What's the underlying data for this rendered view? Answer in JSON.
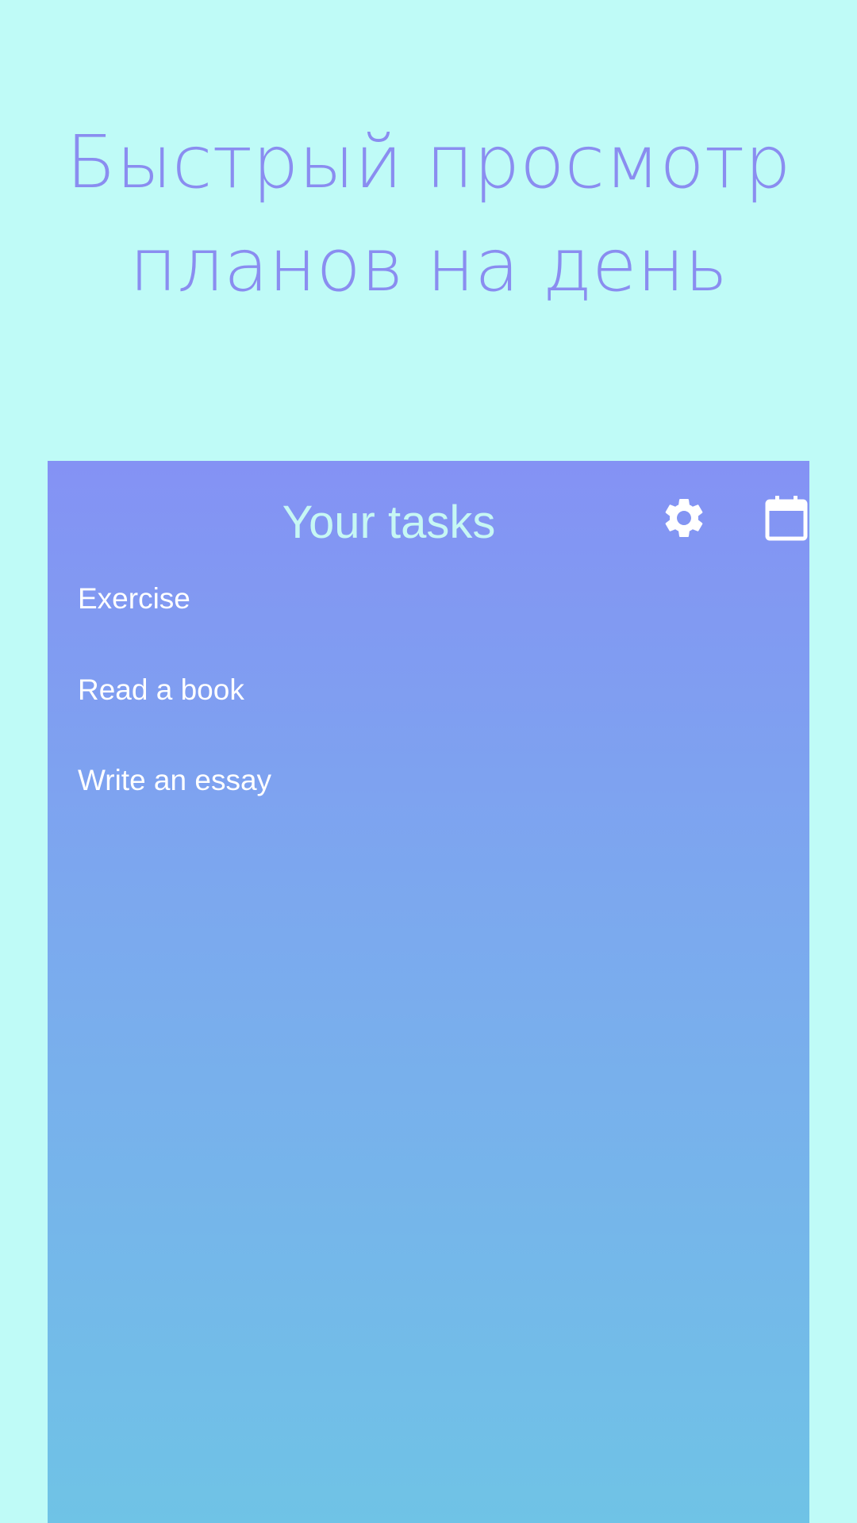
{
  "headline": {
    "line1": "Быстрый просмотр",
    "line2": "планов на день"
  },
  "card": {
    "title": "Your tasks",
    "icons": {
      "settings": "gear-icon",
      "calendar": "calendar-icon"
    },
    "tasks": [
      "Exercise",
      "Read a book",
      "Write an essay"
    ]
  },
  "colors": {
    "background": "#bffbf7",
    "headline": "#8a8df0",
    "card_top": "#8492f4",
    "card_bottom": "#6fc3e6",
    "card_title": "#c6f7f4",
    "task_text": "#ffffff"
  }
}
